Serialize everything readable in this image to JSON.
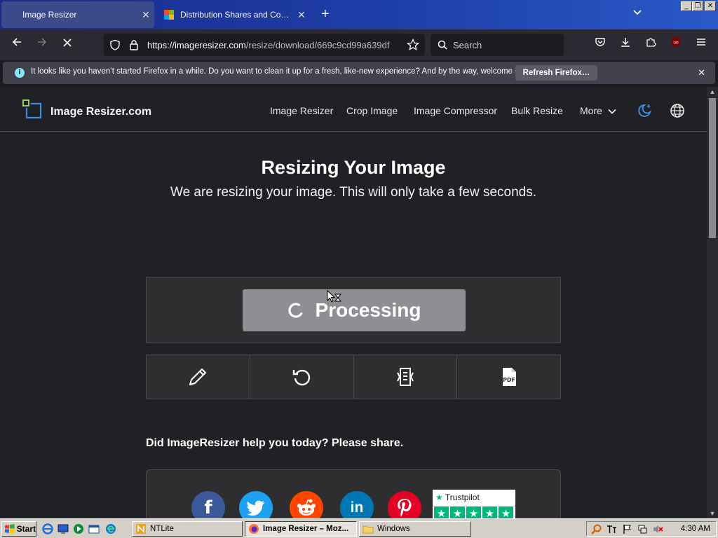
{
  "browser": {
    "tabs": [
      {
        "label": "Image Resizer",
        "active": true
      },
      {
        "label": "Distribution Shares and Configuratio",
        "active": false
      }
    ],
    "url_base": "https://imageresizer.com",
    "url_path": "/resize/download/669c9cd99a639df",
    "search_placeholder": "Search",
    "notification": {
      "message": "It looks like you haven’t started Firefox in a while. Do you want to clean it up for a fresh, like-new experience? And by the way, welcome back!",
      "button_label": "Refresh Firefox…"
    }
  },
  "site": {
    "logo_text": "Image Resizer.com",
    "nav": [
      {
        "label": "Image Resizer"
      },
      {
        "label": "Crop Image"
      },
      {
        "label": "Image Compressor"
      },
      {
        "label": "Bulk Resize"
      },
      {
        "label": "More"
      }
    ]
  },
  "main": {
    "title": "Resizing Your Image",
    "subtitle": "We are resizing your image. This will only take a few seconds.",
    "processing_label": "Processing",
    "tools": [
      {
        "icon": "pencil-icon"
      },
      {
        "icon": "undo-icon"
      },
      {
        "icon": "compress-icon"
      },
      {
        "icon": "pdf-icon"
      }
    ],
    "share_prompt": "Did ImageResizer help you today? Please share.",
    "social": [
      {
        "icon": "facebook-icon",
        "glyph": "f",
        "color": "#3b5998"
      },
      {
        "icon": "twitter-icon",
        "glyph": "",
        "color": "#1da1f2"
      },
      {
        "icon": "reddit-icon",
        "glyph": "",
        "color": "#ff4500"
      },
      {
        "icon": "linkedin-icon",
        "glyph": "in",
        "color": "#0077b5"
      },
      {
        "icon": "pinterest-icon",
        "glyph": "P",
        "color": "#e60023"
      }
    ],
    "trustpilot_label": "Trustpilot"
  },
  "taskbar": {
    "start_label": "Start",
    "buttons": [
      {
        "label": "NTLite",
        "pressed": false
      },
      {
        "label": "Image Resizer – Moz...",
        "pressed": true
      },
      {
        "label": "Windows",
        "pressed": false
      }
    ],
    "clock": "4:30 AM"
  },
  "colors": {
    "accent_blue": "#3c8dde",
    "page_bg": "#202124",
    "processing_btn": "#8e8e93",
    "trustpilot_green": "#00b67a"
  }
}
